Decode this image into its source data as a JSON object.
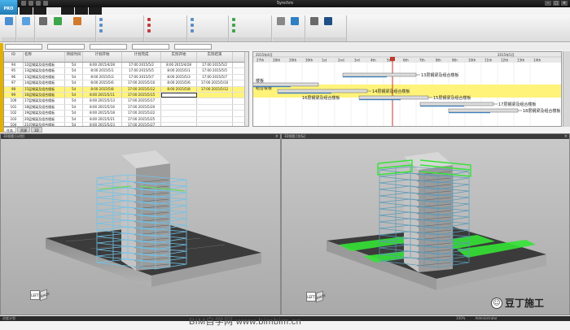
{
  "app": {
    "logo_text": "PRO",
    "window_title": "Synchro",
    "tabs": [
      "",
      "",
      "",
      "",
      "",
      ""
    ],
    "active_tab": 2
  },
  "grid": {
    "headers": [
      "ID",
      "名称",
      "持续时间",
      "计划开始",
      "计划完成",
      "实际开始",
      "实际结束"
    ],
    "rows": [
      [
        "94",
        "12层钢梁及组合楼板",
        "5d",
        "8:00 2015/4/28",
        "17:00 2015/5/2",
        "8:00 2015/4/28",
        "17:00 2015/5/2"
      ],
      [
        "95",
        "13层钢梁及组合楼板",
        "5d",
        "8:00 2015/5/1",
        "17:00 2015/5/5",
        "8:00 2015/5/1",
        "17:00 2015/5/5"
      ],
      [
        "96",
        "13层钢梁及组合楼板",
        "5d",
        "8:00 2015/5/3",
        "17:00 2015/5/7",
        "8:00 2015/5/3",
        "17:00 2015/5/7"
      ],
      [
        "97",
        "14层钢梁及组合楼板",
        "5d",
        "8:00 2015/5/6",
        "17:00 2015/5/10",
        "8:00 2015/5/6",
        "17:00 2015/5/10"
      ],
      [
        "98",
        "15层钢梁及组合楼板",
        "5d",
        "8:00 2015/5/8",
        "17:00 2015/5/12",
        "8:00 2015/5/8",
        "17:00 2015/5/12"
      ],
      [
        "99",
        "16层钢梁及组合楼板",
        "5d",
        "8:00 2015/5/11",
        "17:00 2015/5/15",
        "",
        ""
      ],
      [
        "100",
        "17层钢梁及组合楼板",
        "5d",
        "8:00 2015/5/13",
        "17:00 2015/5/17",
        "",
        ""
      ],
      [
        "101",
        "18层钢梁及组合楼板",
        "5d",
        "8:00 2015/5/16",
        "17:00 2015/5/20",
        "",
        ""
      ],
      [
        "102",
        "19层钢梁及组合楼板",
        "5d",
        "8:00 2015/5/18",
        "17:00 2015/5/22",
        "",
        ""
      ],
      [
        "103",
        "20层钢梁及组合楼板",
        "5d",
        "8:00 2015/5/21",
        "17:00 2015/5/25",
        "",
        ""
      ],
      [
        "104",
        "21层钢梁及组合楼板",
        "5d",
        "8:00 2015/5/23",
        "17:00 2015/5/27",
        "",
        ""
      ]
    ],
    "highlight_rows": [
      4,
      5
    ]
  },
  "gantt": {
    "header_top": "2015年4月",
    "header_top_right": "2015年5月",
    "days": [
      "27th",
      "28th",
      "29th",
      "30th",
      "1st",
      "2nd",
      "3rd",
      "4th",
      "5th",
      "6th",
      "7th",
      "8th",
      "9th",
      "10th",
      "11th",
      "12th",
      "13th",
      "14th"
    ],
    "labels": [
      "13层钢梁及组合楼板",
      "14层钢梁及组合楼板",
      "15层钢梁及组合楼板",
      "16层钢梁及组合楼板",
      "17层钢梁及组合楼板",
      "18层钢梁及组合楼板"
    ],
    "left_labels": [
      "楼板",
      "组合楼板"
    ]
  },
  "subtabs": [
    "任务",
    "资源",
    "3D"
  ],
  "views": {
    "left_title": "3D视图 [计划]",
    "right_title": "3D视图 [实际]",
    "cube_front": "LEFT",
    "cube_side": "BACK"
  },
  "status": {
    "left": "进度计划",
    "right": [
      "100%",
      "Administrator"
    ]
  },
  "watermark": "BIM自学网 www.bimbim.cn",
  "brand": "豆丁施工",
  "colors": {
    "highlight": "#fff37a",
    "planned_steel": "#6fc3ea",
    "active_green": "#35e335",
    "accent": "#e2b100"
  }
}
